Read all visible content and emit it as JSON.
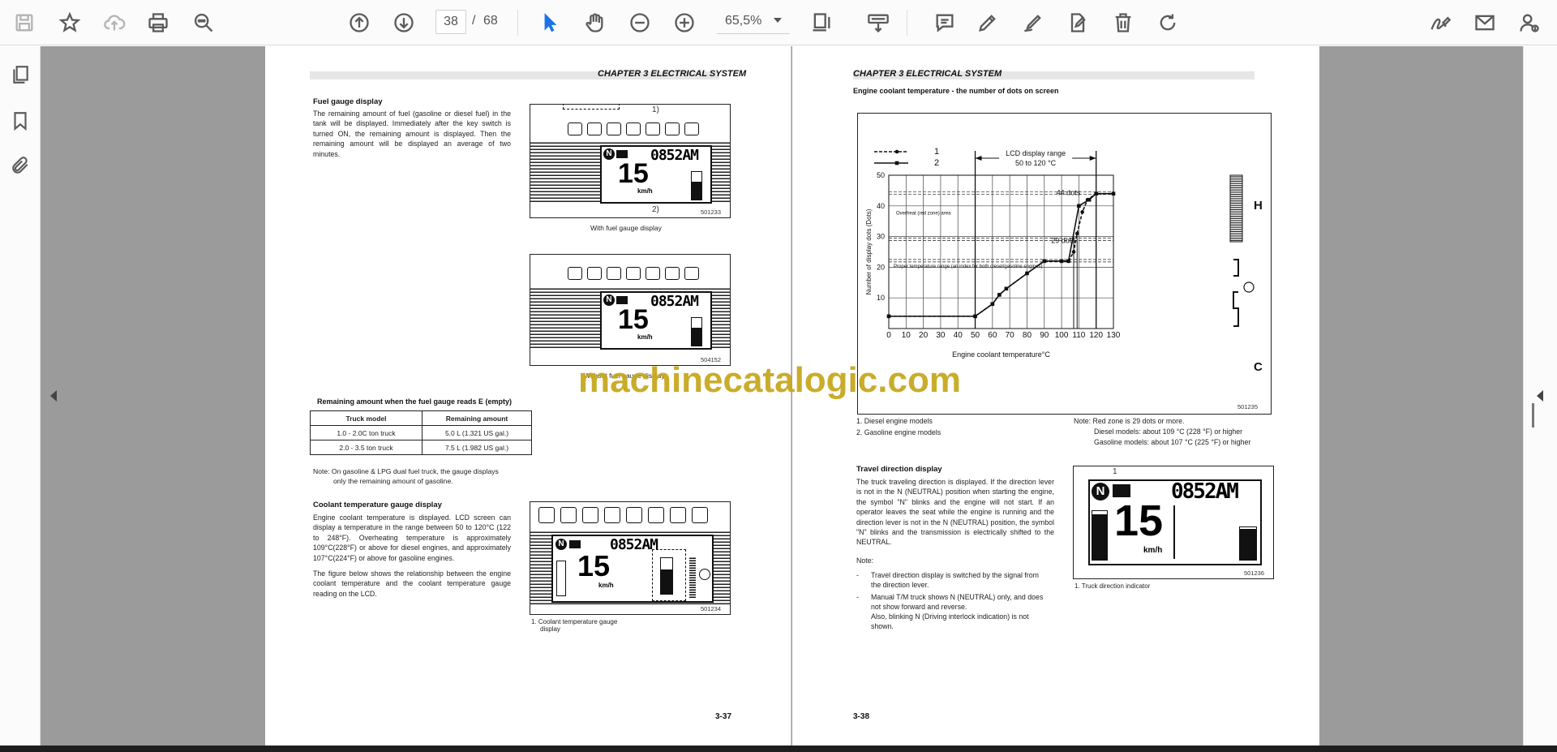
{
  "toolbar": {
    "current_page": "38",
    "slash": "/",
    "total_pages": "68",
    "zoom": "65,5%"
  },
  "left_page": {
    "chapter": "CHAPTER 3 ELECTRICAL SYSTEM",
    "fuel_heading": "Fuel gauge display",
    "fuel_text": "The remaining amount of fuel (gasoline or diesel fuel) in the tank will be displayed. Immediately after the key switch is turned ON, the remaining amount is displayed. Then the remaining amount will be displayed an average of two minutes.",
    "fig1_callout1": "1)",
    "fig1_callout2": "2)",
    "fig1_id": "501233",
    "fig1_caption": "With fuel gauge display",
    "fig2_id": "504152",
    "fig2_caption": "Without fuel gauge display",
    "table_title": "Remaining amount when the fuel gauge reads E (empty)",
    "table_headers": [
      "Truck model",
      "Remaining amount"
    ],
    "table_rows": [
      [
        "1.0 - 2.0C ton truck",
        "5.0 L (1.321 US gal.)"
      ],
      [
        "2.0 - 3.5 ton truck",
        "7.5 L (1.982 US gal.)"
      ]
    ],
    "note": "Note: On gasoline & LPG dual fuel truck, the gauge displays",
    "note2": "only the remaining amount of gasoline.",
    "coolant_heading": "Coolant temperature gauge display",
    "coolant_text1": "Engine coolant temperature is displayed. LCD screen can display a temperature in the range between 50 to 120°C (122 to 248°F). Overheating temperature is approximately 109°C(228°F) or above for diesel engines, and approximately 107°C(224°F) or above for gasoline engines.",
    "coolant_text2": "The figure below shows the relationship between the engine coolant temperature and the coolant temperature gauge reading on the LCD.",
    "fig3_id": "501234",
    "fig3_caption1": "1.  Coolant temperature gauge",
    "fig3_caption2": "display",
    "page_number": "3-37",
    "lcd_time": "0852AM",
    "lcd_speed": "15",
    "lcd_unit": "km/h",
    "lcd_n": "N"
  },
  "right_page": {
    "chapter": "CHAPTER 3 ELECTRICAL SYSTEM",
    "chart_heading": "Engine coolant temperature - the number of dots on screen",
    "legend1": "1",
    "legend2": "2",
    "lcd_range1": "LCD display range",
    "lcd_range2": "50 to 120 °C",
    "dots44": "44 dots",
    "dots29": "29 dots",
    "overheat": "Overheat (red zone) area",
    "proper": "Proper temperature range (an index for both diesel/gasoline engines)",
    "h_label": "H",
    "c_label": "C",
    "chart_id": "501235",
    "items": [
      "1.    Diesel engine models",
      "2.    Gasoline engine models"
    ],
    "note_red": "Note: Red zone is 29 dots or more.",
    "note_diesel": "Diesel models: about 109 °C (228 °F) or higher",
    "note_gas": "Gasoline models: about 107 °C (225 °F) or higher",
    "travel_heading": "Travel direction display",
    "travel_text": "The truck traveling direction is displayed. If the direction lever is not in the N (NEUTRAL) position when starting the engine, the symbol \"N\" blinks and the engine will not start. If an operator leaves the seat while the engine is running and the direction lever is not in the N (NEUTRAL) position, the symbol \"N\" blinks and the transmission is electrically shifted to the NEUTRAL.",
    "note_label": "Note:",
    "bullet1a": "Travel direction display is switched by the signal from",
    "bullet1b": "the direction lever.",
    "bullet2a": "Manual T/M truck shows N (NEUTRAL) only, and does",
    "bullet2b": "not show forward and reverse.",
    "bullet2c": "Also, blinking N (Driving interlock indication) is not",
    "bullet2d": "shown.",
    "dash": "-",
    "fig4_callout": "1",
    "fig4_id": "501236",
    "fig4_caption": "1.  Truck direction indicator",
    "page_number": "3-38"
  },
  "watermark": "machinecatalogic.com",
  "chart_data": {
    "type": "line",
    "xlabel": "Engine coolant temperature°C",
    "ylabel": "Number of display dots (Dots)",
    "xlim": [
      0,
      130
    ],
    "ylim": [
      0,
      50
    ],
    "xticks": [
      "0",
      "10",
      "20",
      "30",
      "40",
      "50",
      "60",
      "70",
      "80",
      "90",
      "100",
      "110",
      "120",
      "130"
    ],
    "yticks": [
      "10",
      "20",
      "30",
      "40",
      "50"
    ],
    "series": [
      {
        "name": "1",
        "style": "dashed",
        "x": [
          0,
          50,
          60,
          64,
          68,
          80,
          90,
          100,
          104,
          107,
          109,
          112,
          115,
          120
        ],
        "y": [
          4,
          4,
          8,
          11,
          13,
          18,
          22,
          22,
          22,
          25,
          31,
          38,
          42,
          44
        ]
      },
      {
        "name": "2",
        "style": "solid",
        "x": [
          0,
          50,
          60,
          64,
          68,
          80,
          90,
          100,
          104,
          110,
          116,
          120,
          130
        ],
        "y": [
          4,
          4,
          8,
          11,
          13,
          18,
          22,
          22,
          22,
          40,
          42,
          44,
          44
        ]
      }
    ],
    "reference_lines_y": [
      44,
      29,
      22
    ],
    "grid": true
  }
}
